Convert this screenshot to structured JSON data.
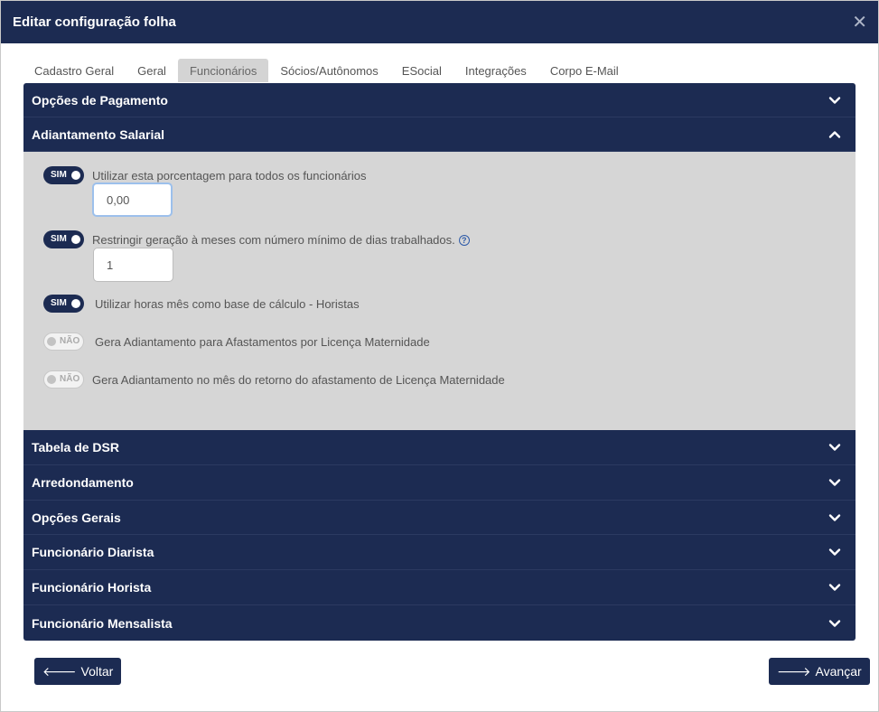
{
  "modal": {
    "title": "Editar configuração folha"
  },
  "tabs": [
    {
      "label": "Cadastro Geral"
    },
    {
      "label": "Geral"
    },
    {
      "label": "Funcionários"
    },
    {
      "label": "Sócios/Autônomos"
    },
    {
      "label": "ESocial"
    },
    {
      "label": "Integrações"
    },
    {
      "label": "Corpo E-Mail"
    }
  ],
  "active_tab": "Funcionários",
  "sections": {
    "opcoes_pagamento": "Opções de Pagamento",
    "adiantamento": "Adiantamento Salarial",
    "dsr": "Tabela de DSR",
    "arredondamento": "Arredondamento",
    "opcoes_gerais": "Opções Gerais",
    "diarista": "Funcionário Diarista",
    "horista": "Funcionário Horista",
    "mensalista": "Funcionário Mensalista"
  },
  "adiantamento": {
    "opt1": {
      "toggle": "SIM",
      "label": "Utilizar esta porcentagem para todos os funcionários",
      "value": "0,00"
    },
    "opt2": {
      "toggle": "SIM",
      "label": "Restringir geração à meses com número mínimo de dias trabalhados.",
      "value": "1"
    },
    "opt3": {
      "toggle": "SIM",
      "label": "Utilizar horas mês como base de cálculo - Horistas"
    },
    "opt4": {
      "toggle": "NÃO",
      "label": "Gera Adiantamento para Afastamentos por Licença Maternidade"
    },
    "opt5": {
      "toggle": "NÃO",
      "label": "Gera Adiantamento no mês do retorno do afastamento de Licença Maternidade"
    }
  },
  "buttons": {
    "back": "Voltar",
    "next": "Avançar"
  },
  "colors": {
    "header": "#1c2b52",
    "panel": "#d6d6d6"
  },
  "icons": {
    "close": "close-icon",
    "expand": "chevron-down-icon",
    "collapse": "chevron-up-icon",
    "help": "question-circle-icon",
    "back": "arrow-left-icon",
    "next": "arrow-right-icon"
  }
}
